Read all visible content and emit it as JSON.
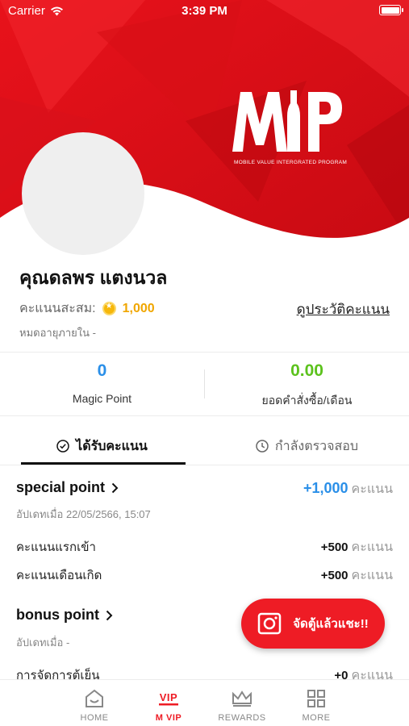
{
  "status_bar": {
    "carrier": "Carrier",
    "time": "3:39 PM"
  },
  "brand": {
    "logo_text": "MVP",
    "tagline": "MOBILE VALUE INTERGRATED PROGRAM",
    "accent_color": "#ee1c25"
  },
  "profile": {
    "name": "คุณดลพร แตงนวล",
    "points_label": "คะแนนสะสม:",
    "points_value": "1,000",
    "history_link": "ดูประวัติคะแนน",
    "expire_text": "หมดอายุภายใน -"
  },
  "stats": [
    {
      "value": "0",
      "label": "Magic Point",
      "color": "#2a8fe8"
    },
    {
      "value": "0.00",
      "label": "ยอดคำสั่งซื้อ/เดือน",
      "color": "#5cc21d"
    }
  ],
  "tabs": [
    {
      "label": "ได้รับคะแนน",
      "icon": "check-circle-icon",
      "active": true
    },
    {
      "label": "กำลังตรวจสอบ",
      "icon": "clock-icon",
      "active": false
    }
  ],
  "special_point": {
    "title": "special point",
    "updated": "อัปเดทเมื่อ 22/05/2566, 15:07",
    "total": "+1,000",
    "unit": "คะแนน",
    "rows": [
      {
        "label": "คะแนนแรกเข้า",
        "value": "+500",
        "unit": "คะแนน"
      },
      {
        "label": "คะแนนเดือนเกิด",
        "value": "+500",
        "unit": "คะแนน"
      }
    ]
  },
  "bonus_point": {
    "title": "bonus point",
    "updated": "อัปเดทเมื่อ -",
    "rows": [
      {
        "label": "การจัดการตู้เย็น",
        "value": "+0",
        "unit": "คะแนน"
      }
    ]
  },
  "fab": {
    "label": "จัดตู้แล้วแชะ!!",
    "icon": "camera-icon"
  },
  "bottom_nav": [
    {
      "label": "HOME",
      "icon": "home-icon",
      "active": false
    },
    {
      "label": "M VIP",
      "icon": "vip-icon",
      "active": true
    },
    {
      "label": "REWARDS",
      "icon": "crown-icon",
      "active": false
    },
    {
      "label": "MORE",
      "icon": "grid-icon",
      "active": false
    }
  ]
}
